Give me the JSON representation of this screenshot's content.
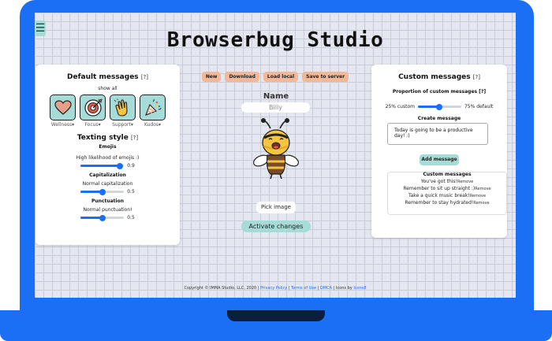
{
  "app": {
    "title": "Browserbug Studio",
    "menu_icon": "hamburger-icon"
  },
  "colors": {
    "frame": "#1a6ff5",
    "accent": "#a7dbd7",
    "toolbar_button": "#f2b89a",
    "slider": "#1a6ff5"
  },
  "default_messages": {
    "title": "Default messages",
    "help": "[?]",
    "show_all": "show all",
    "cards": [
      {
        "label": "Wellness",
        "icon": "heart-icon"
      },
      {
        "label": "Focus",
        "icon": "target-icon"
      },
      {
        "label": "Support",
        "icon": "clapping-hands-icon"
      },
      {
        "label": "Kudos",
        "icon": "party-popper-icon"
      }
    ],
    "dropdown_glyph": "▾"
  },
  "texting_style": {
    "title": "Texting style",
    "help": "[?]",
    "emojis": {
      "label": "Emojis",
      "description": "High likelihood of emojis :)",
      "value": "0.9",
      "level": 0.9
    },
    "capitalization": {
      "label": "Capitalization",
      "description": "Normal capitalization",
      "value": "0.5",
      "level": 0.5
    },
    "punctuation": {
      "label": "Punctuation",
      "description": "Normal punctuation!",
      "value": "0.5",
      "level": 0.5
    }
  },
  "toolbar": {
    "new": "New",
    "download": "Download",
    "load_local": "Load local",
    "save_to_server": "Save to server"
  },
  "bot": {
    "name_label": "Name",
    "name_value": "Billy",
    "pick_image": "Pick image",
    "activate": "Activate changes"
  },
  "custom_messages": {
    "title": "Custom messages",
    "help": "[?]",
    "proportion_title": "Proportion of custom messages [?]",
    "min_label": "25% custom",
    "max_label": "75% default",
    "level": 0.5,
    "create_label": "Create message",
    "input_value": "Today is going to be a productive day! :)",
    "add_button": "Add message",
    "list_title": "Custom messages",
    "items": [
      "You've got this!",
      "Remember to sit up straight :)",
      "Take a quick music break!",
      "Remember to stay hydrated!"
    ],
    "remove_label": "Remove"
  },
  "footer": {
    "copyright": "Copyright © IMMA Studio, LLC, 2020 | ",
    "privacy": "Privacy Policy",
    "sep1": " | ",
    "terms": "Terms of Use",
    "sep2": " | ",
    "dmca": "DMCA",
    "icons_by": " | Icons by ",
    "icons_link": "Icons8"
  }
}
